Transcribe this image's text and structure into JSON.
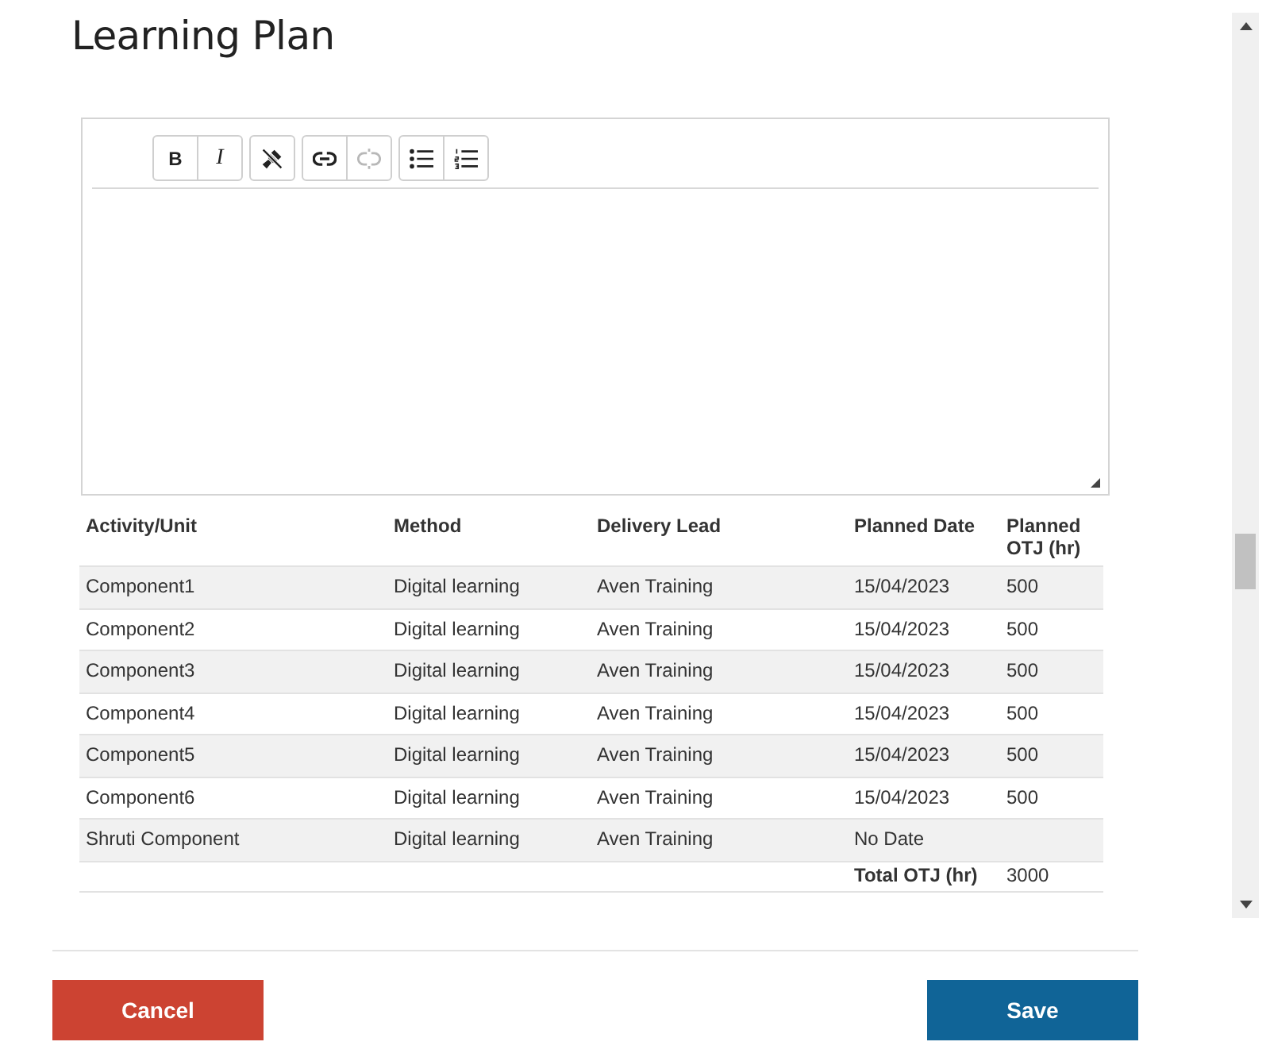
{
  "page_title": "Learning Plan",
  "editor": {
    "toolbar_groups": [
      {
        "buttons": [
          {
            "kind": "bold",
            "label": "B",
            "disabled": false
          },
          {
            "kind": "italic",
            "label": "I",
            "disabled": false
          }
        ]
      },
      {
        "buttons": [
          {
            "kind": "clear_format",
            "disabled": false
          }
        ]
      },
      {
        "buttons": [
          {
            "kind": "link",
            "disabled": false
          },
          {
            "kind": "unlink",
            "disabled": true
          }
        ]
      },
      {
        "buttons": [
          {
            "kind": "bullet_list",
            "disabled": false
          },
          {
            "kind": "numbered_list",
            "disabled": false
          }
        ]
      }
    ]
  },
  "table": {
    "columns": [
      "Activity/Unit",
      "Method",
      "Delivery Lead",
      "Planned Date",
      "Planned OTJ (hr)"
    ],
    "rows": [
      {
        "cells": [
          "Component1",
          "Digital learning",
          "Aven Training",
          "15/04/2023",
          "500"
        ]
      },
      {
        "cells": [
          "Component2",
          "Digital learning",
          "Aven Training",
          "15/04/2023",
          "500"
        ]
      },
      {
        "cells": [
          "Component3",
          "Digital learning",
          "Aven Training",
          "15/04/2023",
          "500"
        ]
      },
      {
        "cells": [
          "Component4",
          "Digital learning",
          "Aven Training",
          "15/04/2023",
          "500"
        ]
      },
      {
        "cells": [
          "Component5",
          "Digital learning",
          "Aven Training",
          "15/04/2023",
          "500"
        ]
      },
      {
        "cells": [
          "Component6",
          "Digital learning",
          "Aven Training",
          "15/04/2023",
          "500"
        ]
      },
      {
        "cells": [
          "Shruti Component",
          "Digital learning",
          "Aven Training",
          "No Date"
        ]
      }
    ],
    "total": {
      "label": "Total OTJ (hr)",
      "value": "3000"
    }
  },
  "buttons": [
    {
      "kind": "cancel",
      "label": "Cancel"
    },
    {
      "kind": "save",
      "label": "Save"
    }
  ]
}
